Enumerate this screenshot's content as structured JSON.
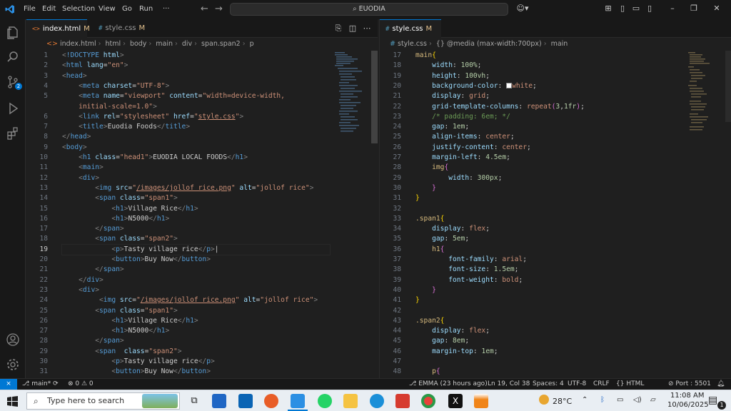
{
  "titlebar": {
    "menus": [
      "File",
      "Edit",
      "Selection",
      "View",
      "Go",
      "Run",
      "···"
    ],
    "search_text": "EUODIA",
    "colors": {
      "accent": "#0078d4"
    }
  },
  "activity_bar": {
    "items": [
      "explorer-icon",
      "search-icon",
      "source-control-icon",
      "run-debug-icon",
      "extensions-icon"
    ],
    "scm_badge": "2",
    "bottom": [
      "account-icon",
      "manage-gear-icon"
    ]
  },
  "left_editor": {
    "tabs": [
      {
        "icon": "<>",
        "label": "index.html",
        "modified": "M",
        "active": true
      },
      {
        "icon": "#",
        "label": "style.css",
        "modified": "M",
        "active": false
      }
    ],
    "breadcrumb": [
      "index.html",
      "html",
      "body",
      "main",
      "div",
      "span.span2",
      "p"
    ],
    "lines": [
      {
        "n": "1",
        "html": "<span class='t-punc'>&lt;</span><span class='t-tag'>!DOCTYPE</span> <span class='t-attr'>html</span><span class='t-punc'>&gt;</span>"
      },
      {
        "n": "2",
        "html": "<span class='t-punc'>&lt;</span><span class='t-tag'>html</span> <span class='t-attr'>lang</span>=<span class='t-str'>\"en\"</span><span class='t-punc'>&gt;</span>"
      },
      {
        "n": "3",
        "html": "<span class='t-punc'>&lt;</span><span class='t-tag'>head</span><span class='t-punc'>&gt;</span>"
      },
      {
        "n": "4",
        "html": "    <span class='t-punc'>&lt;</span><span class='t-tag'>meta</span> <span class='t-attr'>charset</span>=<span class='t-str'>\"UTF-8\"</span><span class='t-punc'>&gt;</span>"
      },
      {
        "n": "5",
        "html": "    <span class='t-punc'>&lt;</span><span class='t-tag'>meta</span> <span class='t-attr'>name</span>=<span class='t-str'>\"viewport\"</span> <span class='t-attr'>content</span>=<span class='t-str'>\"width=device-width,</span>"
      },
      {
        "n": "",
        "html": "    <span class='t-str'>initial-scale=1.0\"</span><span class='t-punc'>&gt;</span>"
      },
      {
        "n": "6",
        "html": "    <span class='t-punc'>&lt;</span><span class='t-tag'>link</span> <span class='t-attr'>rel</span>=<span class='t-str'>\"stylesheet\"</span> <span class='t-attr'>href</span>=<span class='t-str'>\"<u>style.css</u>\"</span><span class='t-punc'>&gt;</span>"
      },
      {
        "n": "7",
        "html": "    <span class='t-punc'>&lt;</span><span class='t-tag'>title</span><span class='t-punc'>&gt;</span>Euodia Foods<span class='t-punc'>&lt;/</span><span class='t-tag'>title</span><span class='t-punc'>&gt;</span>"
      },
      {
        "n": "8",
        "html": "<span class='t-punc'>&lt;/</span><span class='t-tag'>head</span><span class='t-punc'>&gt;</span>"
      },
      {
        "n": "9",
        "html": "<span class='t-punc'>&lt;</span><span class='t-tag'>body</span><span class='t-punc'>&gt;</span>"
      },
      {
        "n": "10",
        "html": "    <span class='t-punc'>&lt;</span><span class='t-tag'>h1</span> <span class='t-attr'>class</span>=<span class='t-str'>\"head1\"</span><span class='t-punc'>&gt;</span>EUODIA LOCAL FOODS<span class='t-punc'>&lt;/</span><span class='t-tag'>h1</span><span class='t-punc'>&gt;</span>"
      },
      {
        "n": "11",
        "html": "    <span class='t-punc'>&lt;</span><span class='t-tag'>main</span><span class='t-punc'>&gt;</span>"
      },
      {
        "n": "12",
        "html": "    <span class='t-punc'>&lt;</span><span class='t-tag'>div</span><span class='t-punc'>&gt;</span>"
      },
      {
        "n": "13",
        "html": "        <span class='t-punc'>&lt;</span><span class='t-tag'>img</span> <span class='t-attr'>src</span>=<span class='t-str'>\"<u>/images/jollof rice.png</u>\"</span> <span class='t-attr'>alt</span>=<span class='t-str'>\"jollof rice\"</span><span class='t-punc'>&gt;</span>"
      },
      {
        "n": "14",
        "html": "        <span class='t-punc'>&lt;</span><span class='t-tag'>span</span> <span class='t-attr'>class</span>=<span class='t-str'>\"span1\"</span><span class='t-punc'>&gt;</span>"
      },
      {
        "n": "15",
        "html": "            <span class='t-punc'>&lt;</span><span class='t-tag'>h1</span><span class='t-punc'>&gt;</span>Village Rice<span class='t-punc'>&lt;/</span><span class='t-tag'>h1</span><span class='t-punc'>&gt;</span>"
      },
      {
        "n": "16",
        "html": "            <span class='t-punc'>&lt;</span><span class='t-tag'>h1</span><span class='t-punc'>&gt;</span>N5000<span class='t-punc'>&lt;/</span><span class='t-tag'>h1</span><span class='t-punc'>&gt;</span>"
      },
      {
        "n": "17",
        "html": "        <span class='t-punc'>&lt;/</span><span class='t-tag'>span</span><span class='t-punc'>&gt;</span>"
      },
      {
        "n": "18",
        "html": "        <span class='t-punc'>&lt;</span><span class='t-tag'>span</span> <span class='t-attr'>class</span>=<span class='t-str'>\"span2\"</span><span class='t-punc'>&gt;</span>"
      },
      {
        "n": "19",
        "html": "            <span class='t-punc'>&lt;</span><span class='t-tag'>p</span><span class='t-punc'>&gt;</span>Tasty village rice<span class='t-punc'>&lt;/</span><span class='t-tag'>p</span><span class='t-punc'>&gt;</span>|"
      },
      {
        "n": "20",
        "html": "            <span class='t-punc'>&lt;</span><span class='t-tag'>button</span><span class='t-punc'>&gt;</span>Buy Now<span class='t-punc'>&lt;/</span><span class='t-tag'>button</span><span class='t-punc'>&gt;</span>"
      },
      {
        "n": "21",
        "html": "        <span class='t-punc'>&lt;/</span><span class='t-tag'>span</span><span class='t-punc'>&gt;</span>"
      },
      {
        "n": "22",
        "html": "    <span class='t-punc'>&lt;/</span><span class='t-tag'>div</span><span class='t-punc'>&gt;</span>"
      },
      {
        "n": "23",
        "html": "    <span class='t-punc'>&lt;</span><span class='t-tag'>div</span><span class='t-punc'>&gt;</span>"
      },
      {
        "n": "24",
        "html": "         <span class='t-punc'>&lt;</span><span class='t-tag'>img</span> <span class='t-attr'>src</span>=<span class='t-str'>\"<u>/images/jollof rice.png</u>\"</span> <span class='t-attr'>alt</span>=<span class='t-str'>\"jollof rice\"</span><span class='t-punc'>&gt;</span>"
      },
      {
        "n": "25",
        "html": "        <span class='t-punc'>&lt;</span><span class='t-tag'>span</span> <span class='t-attr'>class</span>=<span class='t-str'>\"span1\"</span><span class='t-punc'>&gt;</span>"
      },
      {
        "n": "26",
        "html": "            <span class='t-punc'>&lt;</span><span class='t-tag'>h1</span><span class='t-punc'>&gt;</span>Village Rice<span class='t-punc'>&lt;/</span><span class='t-tag'>h1</span><span class='t-punc'>&gt;</span>"
      },
      {
        "n": "27",
        "html": "            <span class='t-punc'>&lt;</span><span class='t-tag'>h1</span><span class='t-punc'>&gt;</span>N5000<span class='t-punc'>&lt;/</span><span class='t-tag'>h1</span><span class='t-punc'>&gt;</span>"
      },
      {
        "n": "28",
        "html": "        <span class='t-punc'>&lt;/</span><span class='t-tag'>span</span><span class='t-punc'>&gt;</span>"
      },
      {
        "n": "29",
        "html": "        <span class='t-punc'>&lt;</span><span class='t-tag'>span</span>  <span class='t-attr'>class</span>=<span class='t-str'>\"span2\"</span><span class='t-punc'>&gt;</span>"
      },
      {
        "n": "30",
        "html": "            <span class='t-punc'>&lt;</span><span class='t-tag'>p</span><span class='t-punc'>&gt;</span>Tasty village rice<span class='t-punc'>&lt;/</span><span class='t-tag'>p</span><span class='t-punc'>&gt;</span>"
      },
      {
        "n": "31",
        "html": "            <span class='t-punc'>&lt;</span><span class='t-tag'>button</span><span class='t-punc'>&gt;</span>Buy Now<span class='t-punc'>&lt;/</span><span class='t-tag'>button</span><span class='t-punc'>&gt;</span>"
      }
    ],
    "current_line": "19"
  },
  "right_editor": {
    "tab": {
      "icon": "#",
      "label": "style.css",
      "modified": "M"
    },
    "breadcrumb": [
      "style.css",
      "{} @media (max-width:700px)",
      "main"
    ],
    "lines": [
      {
        "n": "17",
        "html": "<span class='c-sel'>main</span><span class='c-br2'>{</span>"
      },
      {
        "n": "18",
        "html": "    <span class='c-prop'>width</span>: <span class='c-num'>100%</span>;"
      },
      {
        "n": "19",
        "html": "    <span class='c-prop'>height</span>: <span class='c-num'>100vh</span>;"
      },
      {
        "n": "20",
        "html": "    <span class='c-prop'>background-color</span>: <span style='display:inline-block;width:8px;height:8px;background:#fff;border:1px solid #888;vertical-align:-1px'></span><span class='c-val'>white</span>;"
      },
      {
        "n": "21",
        "html": "    <span class='c-prop'>display</span>: <span class='c-val'>grid</span>;"
      },
      {
        "n": "22",
        "html": "    <span class='c-prop'>grid-template-columns</span>: <span class='c-val'>repeat</span><span class='c-br'>(</span><span class='c-num'>3</span>,<span class='c-num'>1fr</span><span class='c-br'>)</span>;"
      },
      {
        "n": "23",
        "html": "    <span class='c-com'>/* padding: 6em; */</span>"
      },
      {
        "n": "24",
        "html": "    <span class='c-prop'>gap</span>: <span class='c-num'>1em</span>;"
      },
      {
        "n": "25",
        "html": "    <span class='c-prop'>align-items</span>: <span class='c-val'>center</span>;"
      },
      {
        "n": "26",
        "html": "    <span class='c-prop'>justify-content</span>: <span class='c-val'>center</span>;"
      },
      {
        "n": "27",
        "html": "    <span class='c-prop'>margin-left</span>: <span class='c-num'>4.5em</span>;"
      },
      {
        "n": "28",
        "html": "    <span class='c-sel'>img</span><span class='c-br'>{</span>"
      },
      {
        "n": "29",
        "html": "        <span class='c-prop'>width</span>: <span class='c-num'>300px</span>;"
      },
      {
        "n": "30",
        "html": "    <span class='c-br'>}</span>"
      },
      {
        "n": "31",
        "html": "<span class='c-br2'>}</span>"
      },
      {
        "n": "32",
        "html": ""
      },
      {
        "n": "33",
        "html": "<span class='c-sel'>.span1</span><span class='c-br2'>{</span>"
      },
      {
        "n": "34",
        "html": "    <span class='c-prop'>display</span>: <span class='c-val'>flex</span>;"
      },
      {
        "n": "35",
        "html": "    <span class='c-prop'>gap</span>: <span class='c-num'>5em</span>;"
      },
      {
        "n": "36",
        "html": "    <span class='c-sel'>h1</span><span class='c-br'>{</span>"
      },
      {
        "n": "37",
        "html": "        <span class='c-prop'>font-family</span>: <span class='c-val'>arial</span>;"
      },
      {
        "n": "38",
        "html": "        <span class='c-prop'>font-size</span>: <span class='c-num'>1.5em</span>;"
      },
      {
        "n": "39",
        "html": "        <span class='c-prop'>font-weight</span>: <span class='c-val'>bold</span>;"
      },
      {
        "n": "40",
        "html": "    <span class='c-br'>}</span>"
      },
      {
        "n": "41",
        "html": "<span class='c-br2'>}</span>"
      },
      {
        "n": "42",
        "html": ""
      },
      {
        "n": "43",
        "html": "<span class='c-sel'>.span2</span><span class='c-br2'>{</span>"
      },
      {
        "n": "44",
        "html": "    <span class='c-prop'>display</span>: <span class='c-val'>flex</span>;"
      },
      {
        "n": "45",
        "html": "    <span class='c-prop'>gap</span>: <span class='c-num'>8em</span>;"
      },
      {
        "n": "46",
        "html": "    <span class='c-prop'>margin-top</span>: <span class='c-num'>1em</span>;"
      },
      {
        "n": "47",
        "html": ""
      },
      {
        "n": "48",
        "html": "    <span class='c-sel'>p</span><span class='c-br'>{</span>"
      }
    ]
  },
  "statusbar": {
    "branch": "main*",
    "problems": "⊗ 0 ⚠ 0",
    "blame": "EMMA (23 hours ago)",
    "position": "Ln 19, Col 38",
    "spaces": "Spaces: 4",
    "encoding": "UTF-8",
    "eol": "CRLF",
    "language": "{} HTML",
    "port": "Port : 5501"
  },
  "taskbar": {
    "search_placeholder": "Type here to search",
    "weather": "28°C",
    "time": "11:08 AM",
    "date": "10/06/2025",
    "notification_count": "1"
  }
}
